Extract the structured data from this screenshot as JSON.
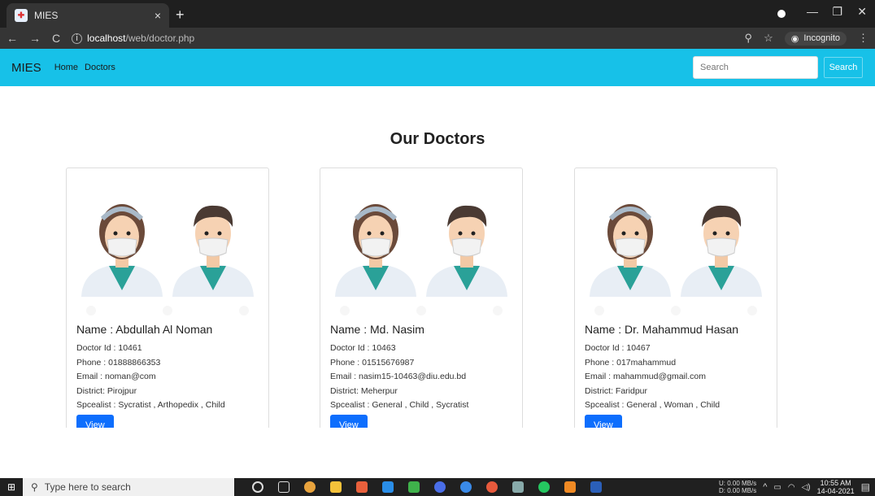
{
  "browser": {
    "tab_title": "MIES",
    "tab_close": "×",
    "new_tab": "+",
    "url_host": "localhost",
    "url_path": "/web/doctor.php",
    "incognito_label": "Incognito"
  },
  "navbar": {
    "brand": "MIES",
    "links": [
      "Home",
      "Doctors"
    ],
    "search_placeholder": "Search",
    "search_button": "Search"
  },
  "page": {
    "title": "Our Doctors"
  },
  "doctors": [
    {
      "name": "Name : Abdullah Al Noman",
      "id": "Doctor Id : 10461",
      "phone": "Phone : 01888866353",
      "email": "Email : noman@com",
      "district": "District: Pirojpur",
      "specialist": "Spcealist : Sycratist , Arthopedix , Child",
      "button": "View"
    },
    {
      "name": "Name : Md. Nasim",
      "id": "Doctor Id : 10463",
      "phone": "Phone : 01515676987",
      "email": "Email : nasim15-10463@diu.edu.bd",
      "district": "District: Meherpur",
      "specialist": "Spcealist : General , Child , Sycratist",
      "button": "View"
    },
    {
      "name": "Name : Dr. Mahammud Hasan",
      "id": "Doctor Id : 10467",
      "phone": "Phone : 017mahammud",
      "email": "Email : mahammud@gmail.com",
      "district": "District: Faridpur",
      "specialist": "Spcealist : General , Woman , Child",
      "button": "View"
    }
  ],
  "taskbar": {
    "search_placeholder": "Type here to search",
    "net_up": "U: 0.00 MB/s",
    "net_down": "D: 0.00 MB/s",
    "time": "10:55 AM",
    "date": "14-04-2021"
  },
  "colors": {
    "navbar_bg": "#17c1e8",
    "button_primary": "#0d6efd"
  }
}
